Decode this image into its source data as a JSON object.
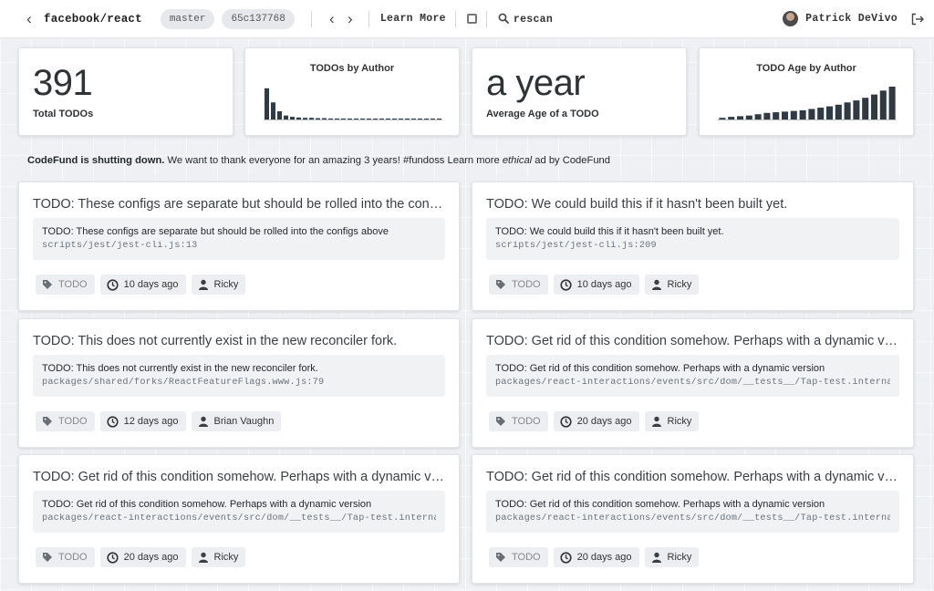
{
  "topbar": {
    "repo": "facebook/react",
    "branch": "master",
    "commit": "65c137768",
    "learn_more": "Learn More",
    "rescan": "rescan",
    "user": "Patrick DeVivo",
    "icons": [
      "chevron-left-icon",
      "chevron-right-icon",
      "square-icon",
      "search-icon",
      "avatar",
      "logout-icon"
    ]
  },
  "stats": {
    "total_value": "391",
    "total_label": "Total TODOs",
    "by_author_title": "TODOs by Author",
    "age_value": "a year",
    "age_label": "Average Age of a TODO",
    "age_by_author_title": "TODO Age by Author",
    "bar_color": "#2f3a44"
  },
  "chart_data": [
    {
      "type": "bar",
      "title": "TODOs by Author",
      "values": [
        95,
        52,
        25,
        12,
        8,
        6,
        5,
        5,
        4,
        4,
        3,
        3,
        3,
        2,
        2,
        2,
        2,
        2,
        2,
        2,
        2,
        1,
        1,
        1,
        1,
        1,
        1,
        1
      ],
      "ylim": [
        0,
        100
      ]
    },
    {
      "type": "bar",
      "title": "TODO Age by Author",
      "values": [
        5,
        8,
        10,
        12,
        16,
        20,
        22,
        24,
        26,
        28,
        32,
        36,
        40,
        45,
        52,
        58,
        66,
        76,
        88,
        100
      ],
      "ylim": [
        0,
        100
      ]
    }
  ],
  "ad": {
    "bold": "CodeFund is shutting down.",
    "text1": " We want to thank everyone for an amazing 3 years! #fundoss Learn more ",
    "italic": "ethical",
    "text2": " ad by CodeFund"
  },
  "todos": [
    {
      "title": "TODO: These configs are separate but should be rolled into the configs above",
      "body": "TODO: These configs are separate but should be rolled into the configs above",
      "path": "scripts/jest/jest-cli.js:13",
      "tag": "TODO",
      "age": "10 days ago",
      "author": "Ricky"
    },
    {
      "title": "TODO: We could build this if it hasn't been built yet.",
      "body": "TODO: We could build this if it hasn't been built yet.",
      "path": "scripts/jest/jest-cli.js:209",
      "tag": "TODO",
      "age": "10 days ago",
      "author": "Ricky"
    },
    {
      "title": "TODO: This does not currently exist in the new reconciler fork.",
      "body": "TODO: This does not currently exist in the new reconciler fork.",
      "path": "packages/shared/forks/ReactFeatureFlags.www.js:79",
      "tag": "TODO",
      "age": "12 days ago",
      "author": "Brian Vaughn"
    },
    {
      "title": "TODO: Get rid of this condition somehow. Perhaps with a dynamic version",
      "body": "TODO: Get rid of this condition somehow. Perhaps with a dynamic version",
      "path": "packages/react-interactions/events/src/dom/__tests__/Tap-test.internal.js",
      "tag": "TODO",
      "age": "20 days ago",
      "author": "Ricky"
    },
    {
      "title": "TODO: Get rid of this condition somehow. Perhaps with a dynamic version",
      "body": "TODO: Get rid of this condition somehow. Perhaps with a dynamic version",
      "path": "packages/react-interactions/events/src/dom/__tests__/Tap-test.internal.js",
      "tag": "TODO",
      "age": "20 days ago",
      "author": "Ricky"
    },
    {
      "title": "TODO: Get rid of this condition somehow. Perhaps with a dynamic version",
      "body": "TODO: Get rid of this condition somehow. Perhaps with a dynamic version",
      "path": "packages/react-interactions/events/src/dom/__tests__/Tap-test.internal.js",
      "tag": "TODO",
      "age": "20 days ago",
      "author": "Ricky"
    }
  ]
}
